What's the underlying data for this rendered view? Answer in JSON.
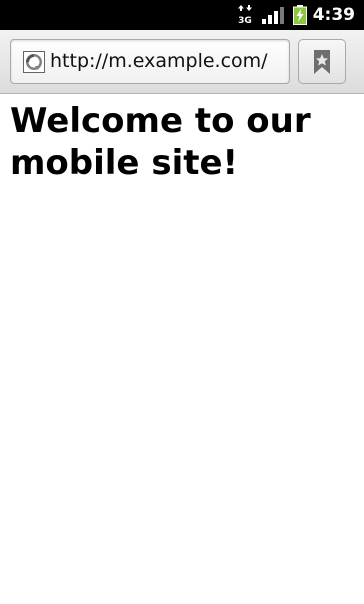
{
  "status_bar": {
    "network_label": "3G",
    "network_icon": "data-3g-icon",
    "signal_icon": "signal-strength-icon",
    "battery_icon": "battery-charging-icon",
    "time": "4:39"
  },
  "browser": {
    "url": "http://m.example.com/",
    "favicon_icon": "globe-icon",
    "bookmark_icon": "bookmark-icon"
  },
  "page": {
    "heading": "Welcome to our mobile site!"
  },
  "colors": {
    "status_bar_bg": "#000000",
    "toolbar_bg": "#e6e6e6",
    "page_bg": "#ffffff",
    "battery_accent": "#8dc63f"
  }
}
